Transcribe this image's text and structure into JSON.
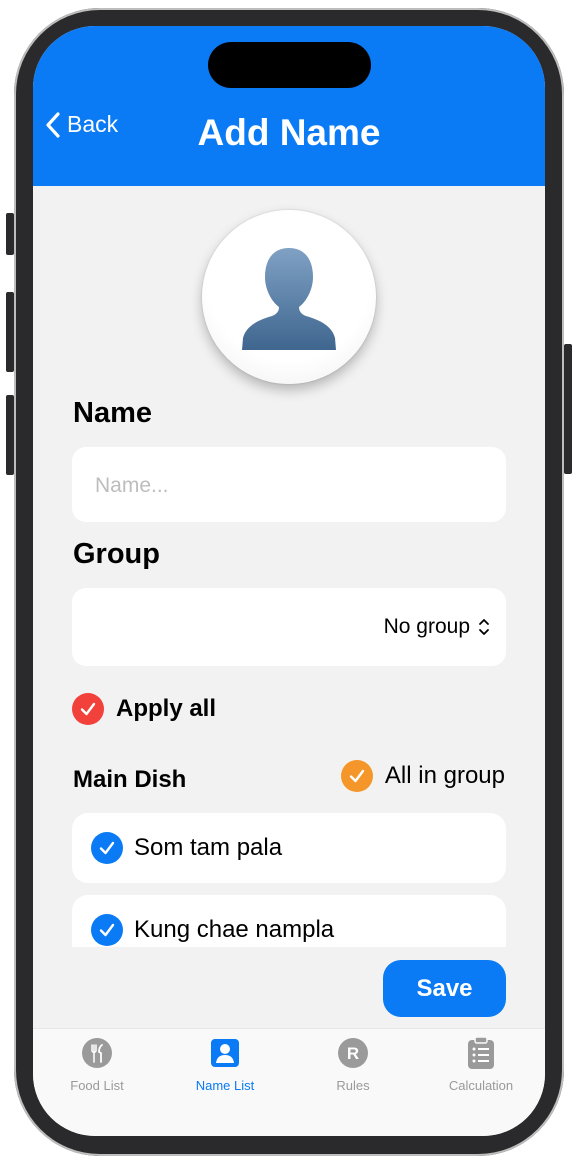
{
  "header": {
    "back_label": "Back",
    "title": "Add Name"
  },
  "form": {
    "name_label": "Name",
    "name_placeholder": "Name...",
    "name_value": "",
    "group_label": "Group",
    "group_selected": "No group",
    "apply_all_label": "Apply all",
    "apply_all_checked": true
  },
  "main_dish": {
    "label": "Main Dish",
    "all_in_group_label": "All in group",
    "all_in_group_checked": true,
    "items": [
      {
        "label": "Som tam pala",
        "checked": true
      },
      {
        "label": "Kung chae nampla",
        "checked": true
      }
    ]
  },
  "save_label": "Save",
  "tabs": [
    {
      "label": "Food List",
      "icon": "fork-knife-icon",
      "active": false
    },
    {
      "label": "Name List",
      "icon": "person-card-icon",
      "active": true
    },
    {
      "label": "Rules",
      "icon": "r-circle-icon",
      "active": false
    },
    {
      "label": "Calculation",
      "icon": "clipboard-list-icon",
      "active": false
    }
  ],
  "colors": {
    "accent": "#0a7bf5",
    "apply_all_check": "#f2403a",
    "all_in_group_check": "#f5962a",
    "item_check": "#0a7bf5",
    "background": "#f2f2f2"
  }
}
